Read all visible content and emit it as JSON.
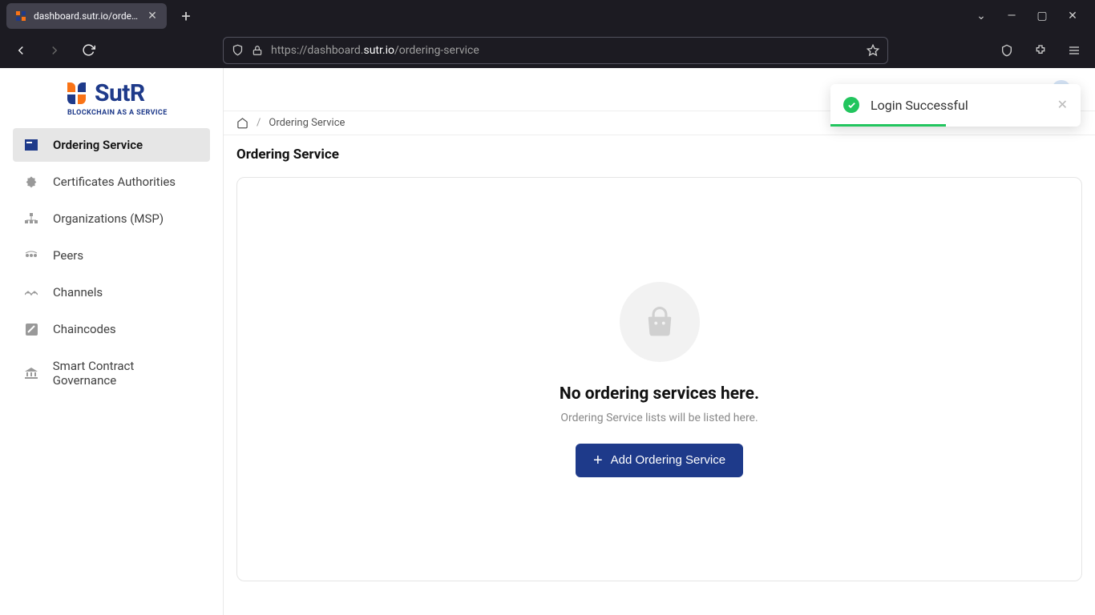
{
  "browser": {
    "tab_title": "dashboard.sutr.io/orderin",
    "url_prefix": "https://",
    "url_host_faded": "dashboard.",
    "url_domain": "sutr.io",
    "url_path": "/ordering-service"
  },
  "brand": {
    "name": "SutR",
    "tagline": "BLOCKCHAIN AS A SERVICE",
    "primary_color": "#1e3a8a",
    "accent_orange": "#f97316"
  },
  "sidebar": {
    "items": [
      {
        "label": "Ordering Service",
        "active": true
      },
      {
        "label": "Certificates Authorities",
        "active": false
      },
      {
        "label": "Organizations (MSP)",
        "active": false
      },
      {
        "label": "Peers",
        "active": false
      },
      {
        "label": "Channels",
        "active": false
      },
      {
        "label": "Chaincodes",
        "active": false
      },
      {
        "label": "Smart Contract Governance",
        "active": false
      }
    ]
  },
  "breadcrumb": {
    "current": "Ordering Service"
  },
  "page": {
    "title": "Ordering Service",
    "empty_title": "No ordering services here.",
    "empty_subtitle": "Ordering Service lists will be listed here.",
    "add_button_label": "Add Ordering Service"
  },
  "toast": {
    "message": "Login Successful"
  }
}
